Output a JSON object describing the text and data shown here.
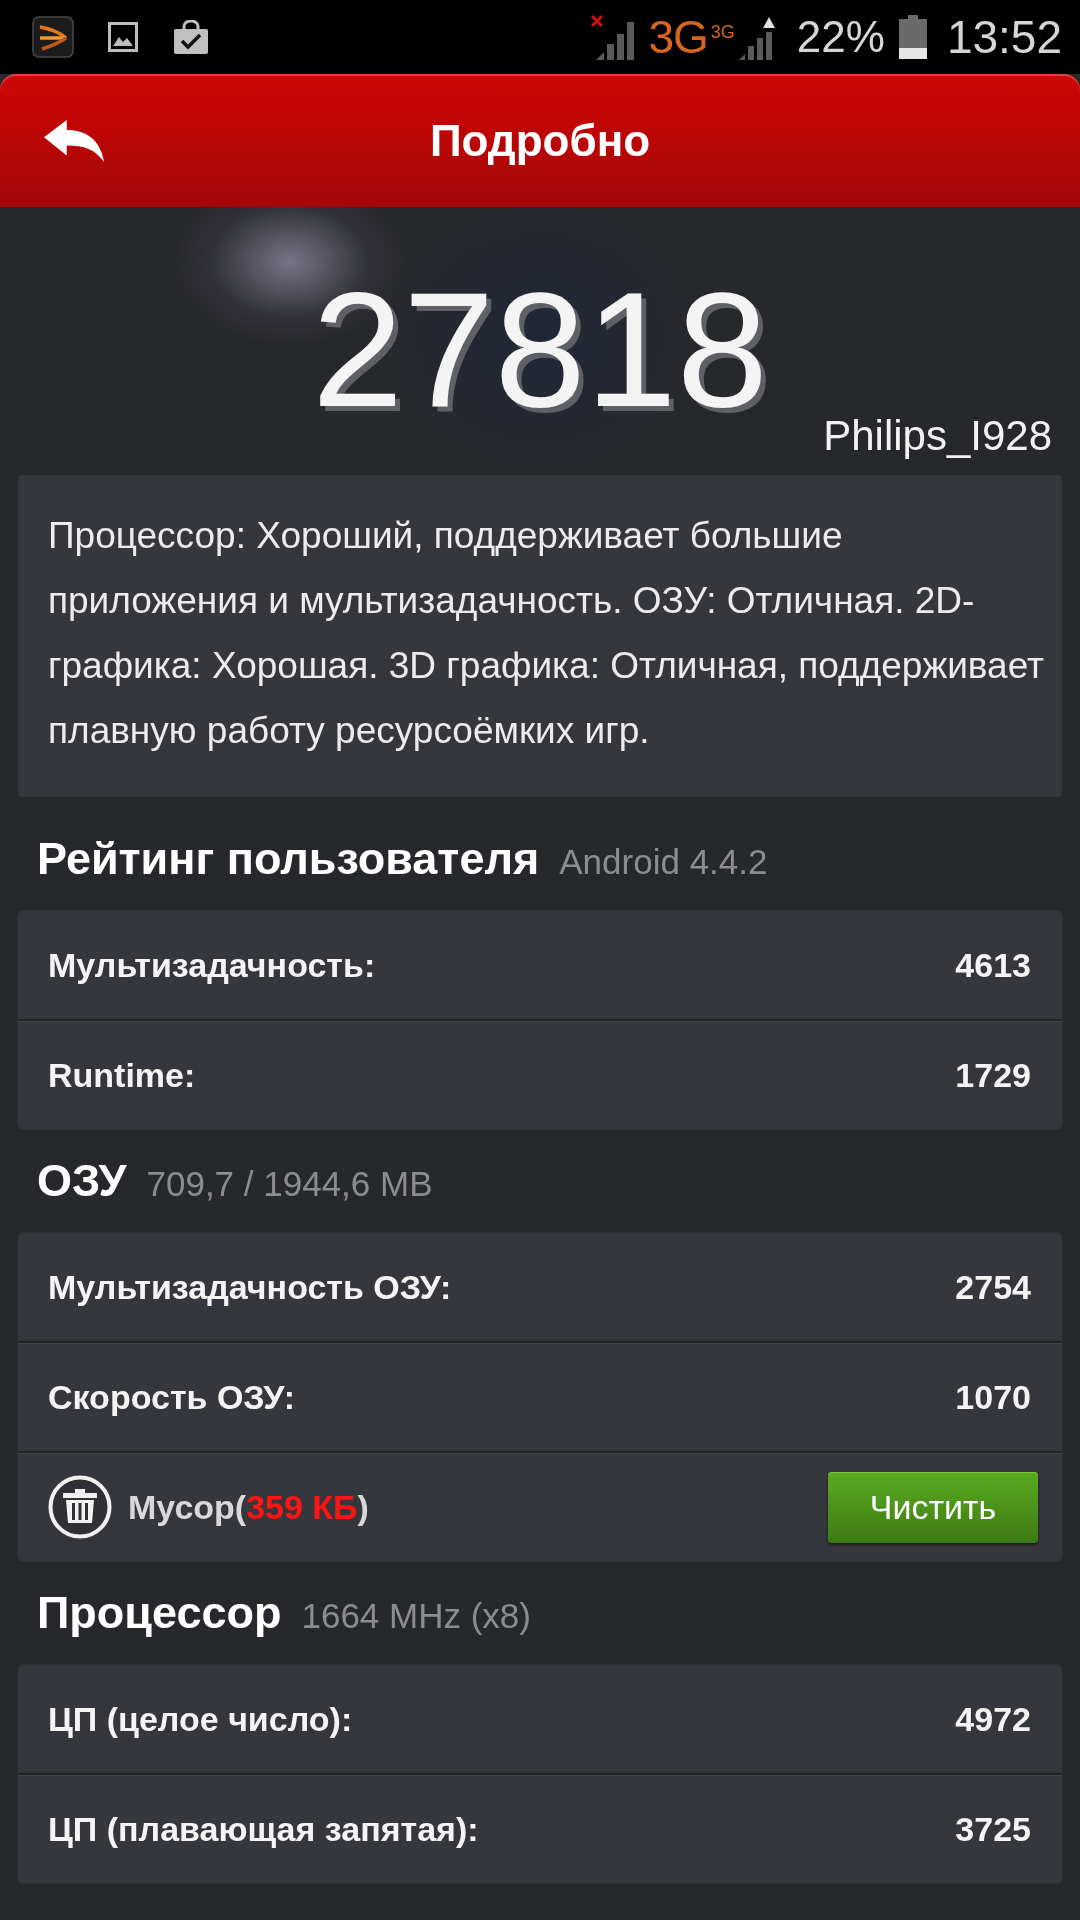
{
  "status_bar": {
    "network": "3G",
    "network_secondary": "3G",
    "battery": "22%",
    "time": "13:52"
  },
  "header": {
    "title": "Подробно"
  },
  "score": {
    "value": "27818",
    "device": "Philips_I928"
  },
  "description": "Процессор: Хороший, поддерживает большие приложения и мультизадачность. ОЗУ: Отличная. 2D-графика: Хорошая. 3D графика: Отличная, поддерживает плавную работу ресурсоёмких игр.",
  "sections": [
    {
      "title": "Рейтинг пользователя",
      "subtitle": "Android 4.4.2",
      "rows": [
        {
          "kind": "metric",
          "label": "Мультизадачность:",
          "value": "4613"
        },
        {
          "kind": "metric",
          "label": "Runtime:",
          "value": "1729"
        }
      ]
    },
    {
      "title": "ОЗУ",
      "subtitle": "709,7 / 1944,6 MB",
      "rows": [
        {
          "kind": "metric",
          "label": "Мультизадачность ОЗУ:",
          "value": "2754"
        },
        {
          "kind": "metric",
          "label": "Скорость ОЗУ:",
          "value": "1070"
        },
        {
          "kind": "cleanup",
          "label": "Мусор(",
          "size": "359 КБ",
          "suffix": ")",
          "button": "Чистить"
        }
      ]
    },
    {
      "title": "Процессор",
      "subtitle": "1664 MHz (x8)",
      "rows": [
        {
          "kind": "metric",
          "label": "ЦП (целое число):",
          "value": "4972"
        },
        {
          "kind": "metric",
          "label": "ЦП (плавающая запятая):",
          "value": "3725"
        }
      ]
    }
  ]
}
